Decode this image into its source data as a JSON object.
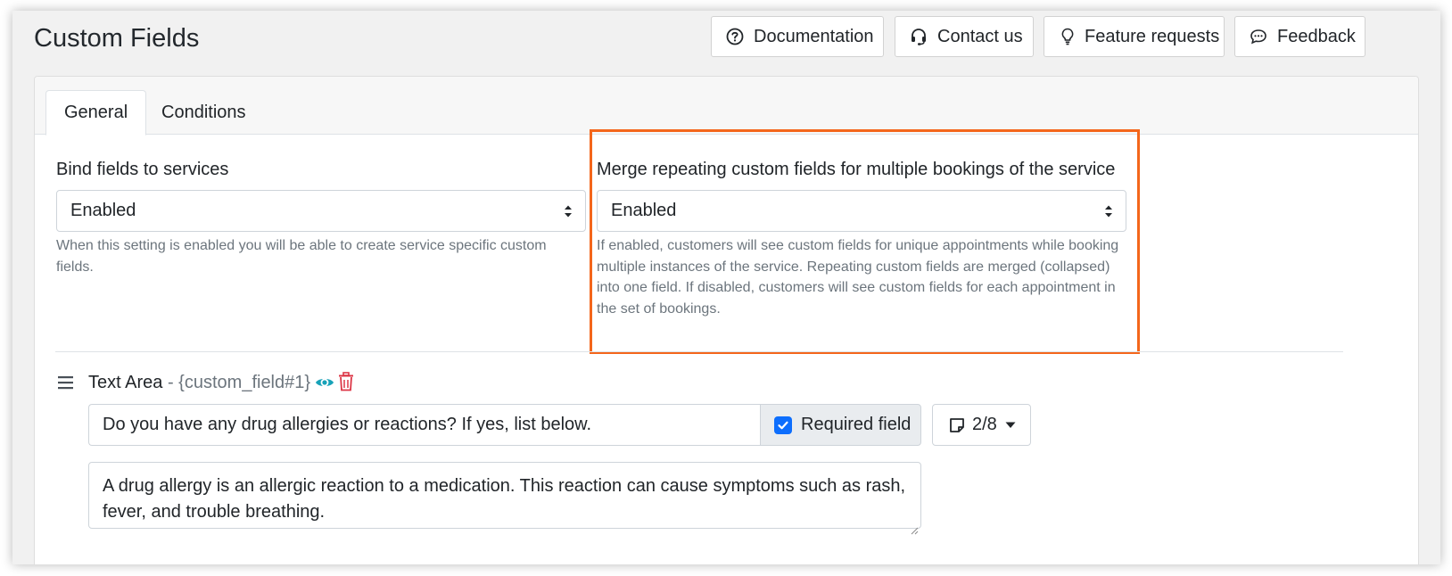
{
  "page": {
    "title": "Custom Fields"
  },
  "header_buttons": {
    "documentation": "Documentation",
    "contact": "Contact us",
    "feature_requests": "Feature requests",
    "feedback": "Feedback"
  },
  "tabs": [
    {
      "label": "General",
      "active": true
    },
    {
      "label": "Conditions",
      "active": false
    }
  ],
  "settings": {
    "bind_fields": {
      "label": "Bind fields to services",
      "value": "Enabled",
      "help": "When this setting is enabled you will be able to create service specific custom fields."
    },
    "merge_fields": {
      "label": "Merge repeating custom fields for multiple bookings of the service",
      "value": "Enabled",
      "help": "If enabled, customers will see custom fields for unique appointments while booking multiple instances of the service. Repeating custom fields are merged (collapsed) into one field. If disabled, customers will see custom fields for each appointment in the set of bookings."
    }
  },
  "field": {
    "type": "Text Area",
    "separator": " - ",
    "code": "{custom_field#1}",
    "question": "Do you have any drug allergies or reactions? If yes, list below.",
    "required_label": "Required field",
    "required_checked": true,
    "counter": "2/8",
    "description": "A drug allergy is an allergic reaction to a medication. This reaction can cause symptoms such as rash, fever, and trouble breathing."
  },
  "colors": {
    "highlight": "#f4661b",
    "eye_icon": "#17a2b8",
    "trash_icon": "#dc3545",
    "checkbox": "#0d6efd"
  },
  "icons": [
    "question-circle-icon",
    "headset-icon",
    "lightbulb-icon",
    "chat-icon",
    "drag-handle-icon",
    "eye-icon",
    "trash-icon",
    "sticky-note-icon",
    "caret-down-icon",
    "checkmark-icon",
    "select-arrows-icon"
  ]
}
